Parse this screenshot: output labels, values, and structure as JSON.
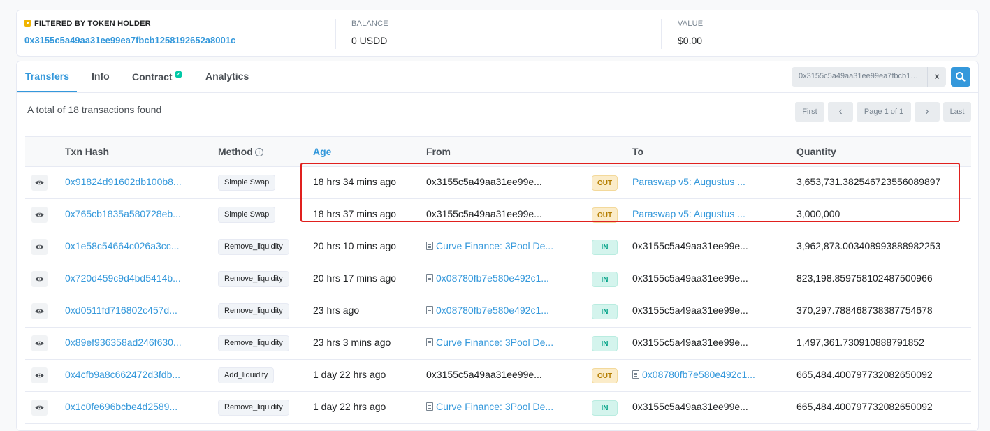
{
  "summary": {
    "filter_label": "FILTERED BY TOKEN HOLDER",
    "holder_address": "0x3155c5a49aa31ee99ea7fbcb1258192652a8001c",
    "balance_label": "BALANCE",
    "balance_value": "0 USDD",
    "value_label": "VALUE",
    "value_value": "$0.00"
  },
  "tabs": {
    "transfers": "Transfers",
    "info": "Info",
    "contract": "Contract",
    "analytics": "Analytics",
    "contract_check": "✓"
  },
  "search": {
    "value": "0x3155c5a49aa31ee99ea7fbcb12...",
    "clear": "×"
  },
  "total_text": "A total of 18 transactions found",
  "pager": {
    "first": "First",
    "prev": "‹",
    "page": "Page 1 of 1",
    "next": "›",
    "last": "Last"
  },
  "columns": {
    "hash": "Txn Hash",
    "method": "Method",
    "method_info": "i",
    "age": "Age",
    "from": "From",
    "to": "To",
    "quantity": "Quantity"
  },
  "rows": [
    {
      "hash": "0x91824d91602db100b8...",
      "method": "Simple Swap",
      "age": "18 hrs 34 mins ago",
      "from": "0x3155c5a49aa31ee99e...",
      "dir": "OUT",
      "to": "Paraswap v5: Augustus ...",
      "qty": "3,653,731.382546723556089897"
    },
    {
      "hash": "0x765cb1835a580728eb...",
      "method": "Simple Swap",
      "age": "18 hrs 37 mins ago",
      "from": "0x3155c5a49aa31ee99e...",
      "dir": "OUT",
      "to": "Paraswap v5: Augustus ...",
      "qty": "3,000,000"
    },
    {
      "hash": "0x1e58c54664c026a3cc...",
      "method": "Remove_liquidity",
      "age": "20 hrs 10 mins ago",
      "from": "Curve Finance: 3Pool De...",
      "dir": "IN",
      "to": "0x3155c5a49aa31ee99e...",
      "qty": "3,962,873.003408993888982253"
    },
    {
      "hash": "0x720d459c9d4bd5414b...",
      "method": "Remove_liquidity",
      "age": "20 hrs 17 mins ago",
      "from": "0x08780fb7e580e492c1...",
      "dir": "IN",
      "to": "0x3155c5a49aa31ee99e...",
      "qty": "823,198.859758102487500966"
    },
    {
      "hash": "0xd0511fd716802c457d...",
      "method": "Remove_liquidity",
      "age": "23 hrs ago",
      "from": "0x08780fb7e580e492c1...",
      "dir": "IN",
      "to": "0x3155c5a49aa31ee99e...",
      "qty": "370,297.788468738387754678"
    },
    {
      "hash": "0x89ef936358ad246f630...",
      "method": "Remove_liquidity",
      "age": "23 hrs 3 mins ago",
      "from": "Curve Finance: 3Pool De...",
      "dir": "IN",
      "to": "0x3155c5a49aa31ee99e...",
      "qty": "1,497,361.730910888791852"
    },
    {
      "hash": "0x4cfb9a8c662472d3fdb...",
      "method": "Add_liquidity",
      "age": "1 day 22 hrs ago",
      "from": "0x3155c5a49aa31ee99e...",
      "dir": "OUT",
      "to": "0x08780fb7e580e492c1...",
      "qty": "665,484.400797732082650092"
    },
    {
      "hash": "0x1c0fe696bcbe4d2589...",
      "method": "Remove_liquidity",
      "age": "1 day 22 hrs ago",
      "from": "Curve Finance: 3Pool De...",
      "dir": "IN",
      "to": "0x3155c5a49aa31ee99e...",
      "qty": "665,484.400797732082650092"
    }
  ],
  "colors": {
    "accent": "#3498db",
    "highlight_box": "#e0201e",
    "out_badge": "#fbecc9",
    "in_badge": "#d4f4ed"
  }
}
